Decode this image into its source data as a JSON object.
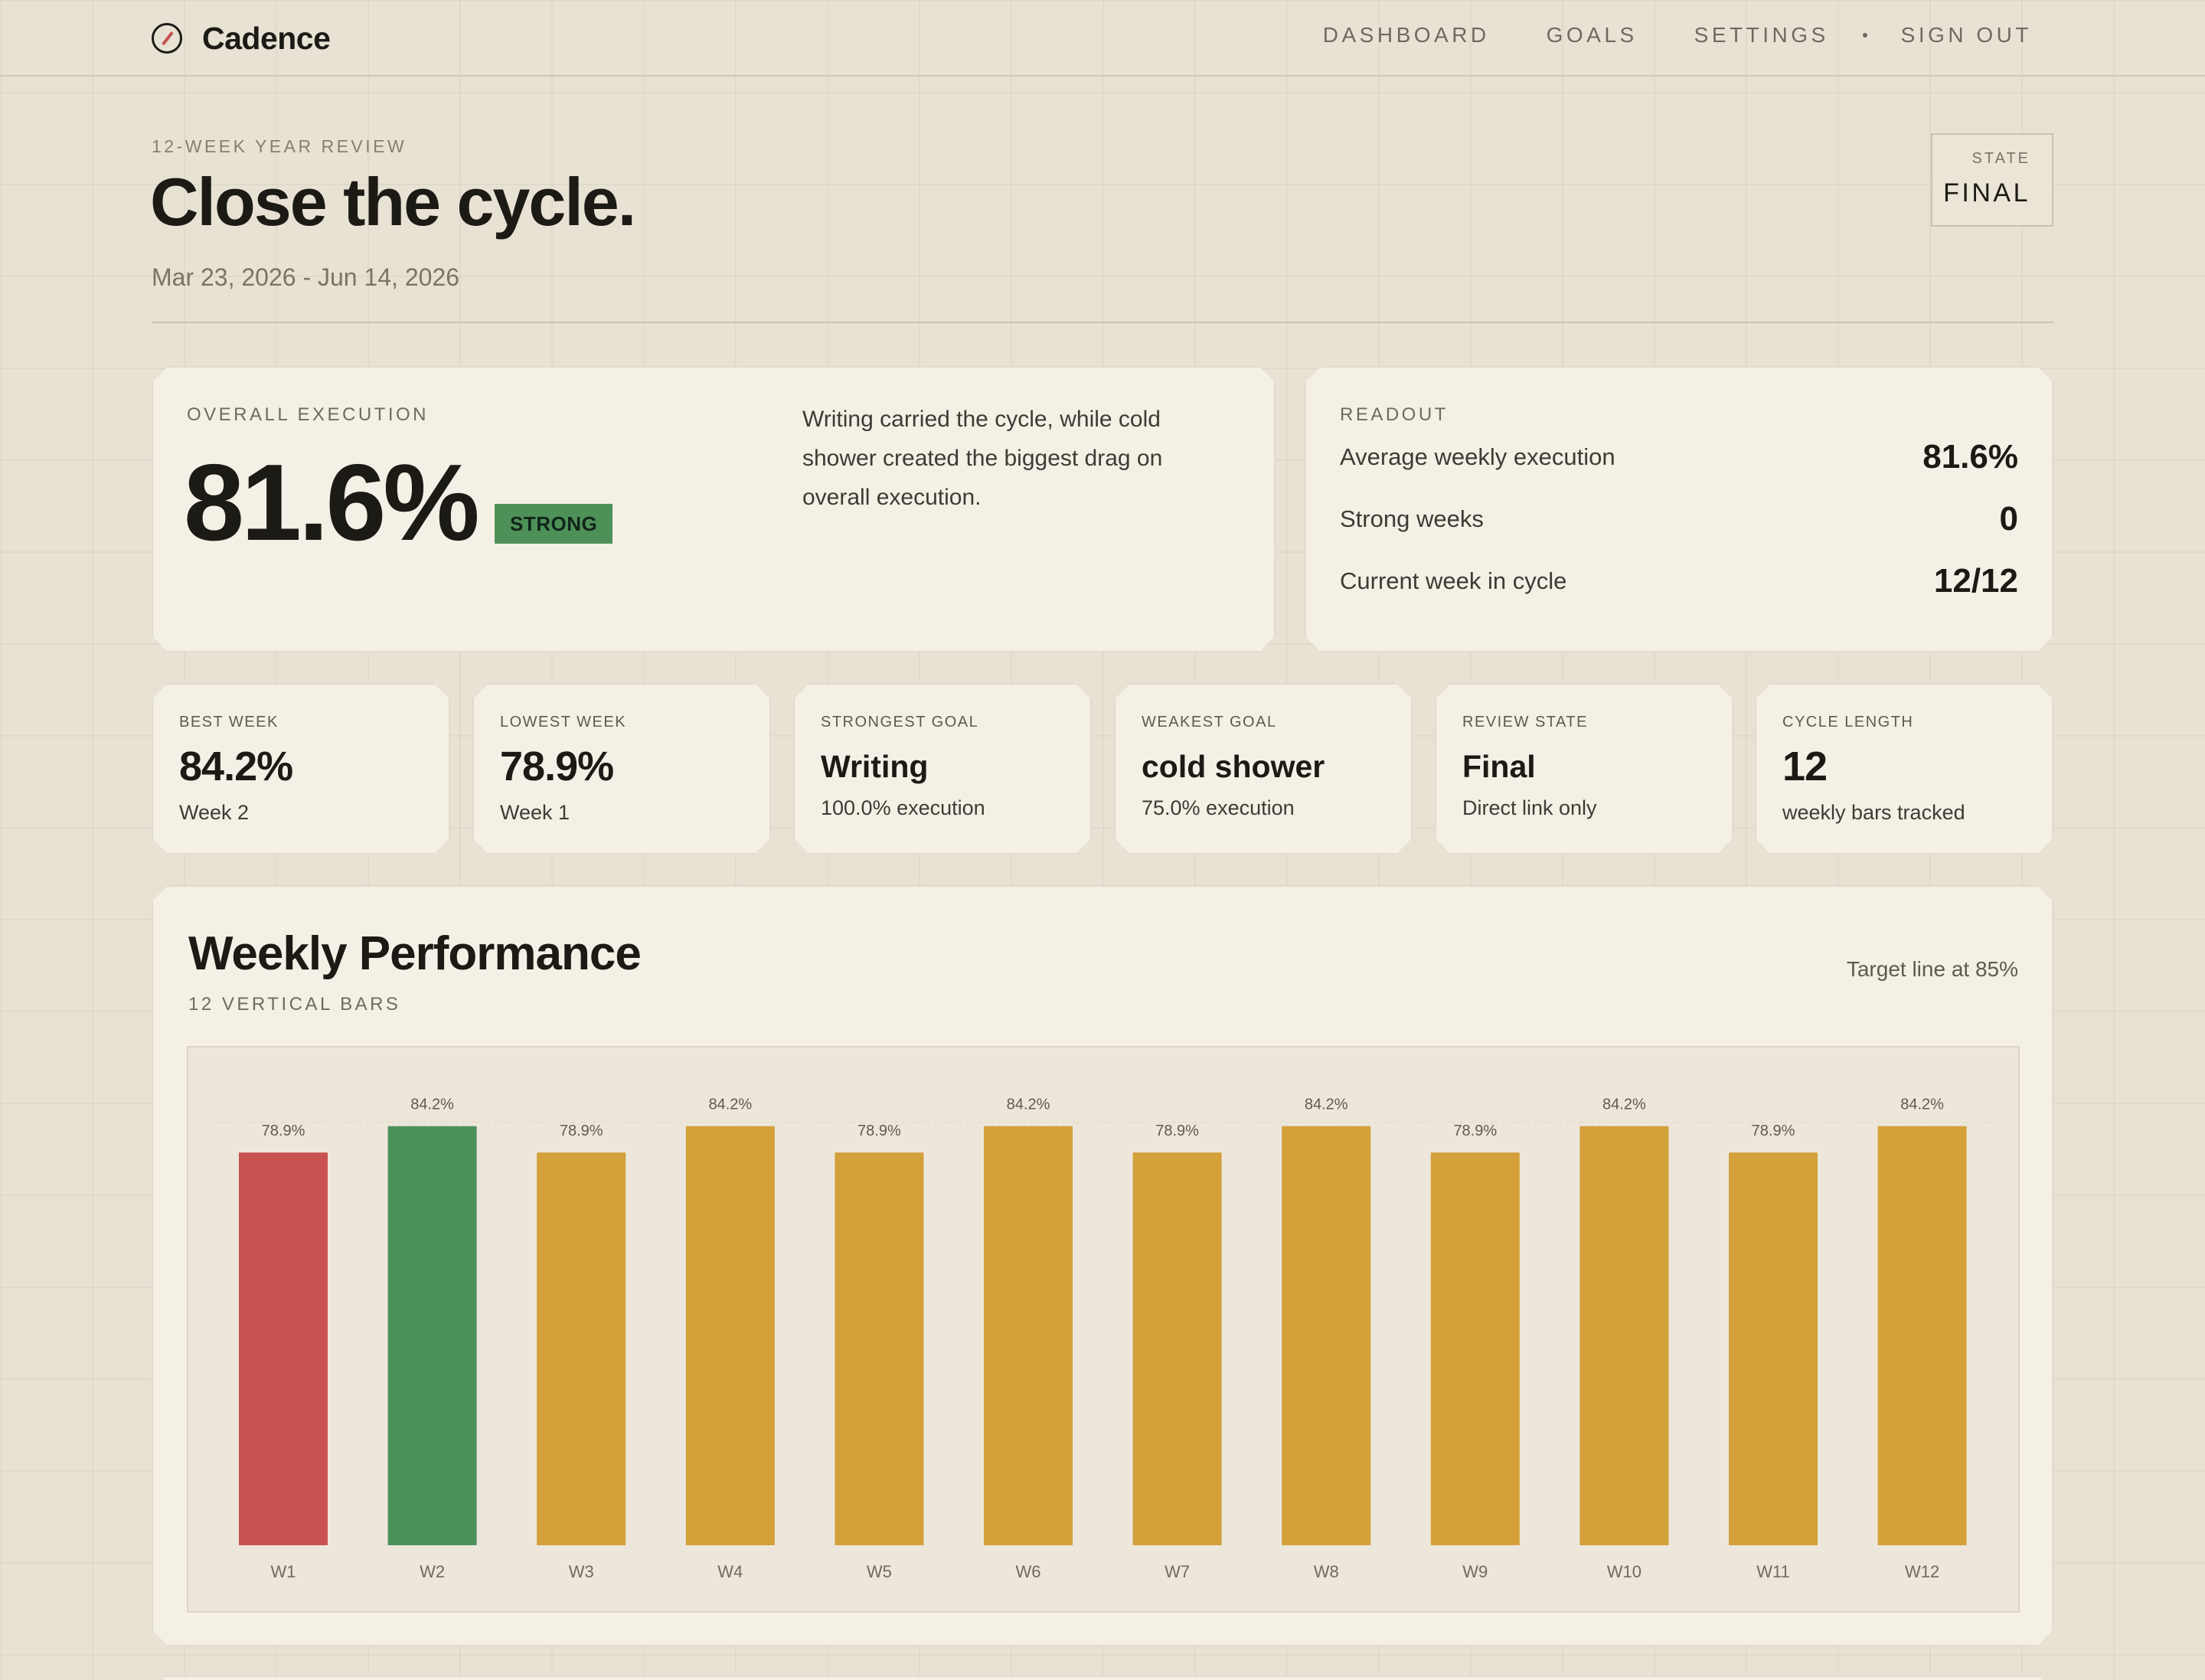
{
  "app": {
    "name": "Cadence",
    "nav": [
      "DASHBOARD",
      "GOALS",
      "SETTINGS"
    ],
    "sign_out": "SIGN OUT"
  },
  "review": {
    "eyebrow": "12-WEEK YEAR REVIEW",
    "title": "Close the cycle.",
    "date_range": "Mar 23, 2026 - Jun 14, 2026",
    "state_label": "STATE",
    "state_value": "FINAL"
  },
  "execution": {
    "label": "OVERALL EXECUTION",
    "value": "81.6%",
    "badge": "STRONG",
    "summary": "Writing carried the cycle, while cold shower created the biggest drag on overall execution."
  },
  "readout": {
    "label": "READOUT",
    "rows": [
      {
        "key": "Average weekly execution",
        "value": "81.6%"
      },
      {
        "key": "Strong weeks",
        "value": "0"
      },
      {
        "key": "Current week in cycle",
        "value": "12/12"
      }
    ]
  },
  "stats": [
    {
      "label": "BEST WEEK",
      "value": "84.2%",
      "sub": "Week 2"
    },
    {
      "label": "LOWEST WEEK",
      "value": "78.9%",
      "sub": "Week 1"
    },
    {
      "label": "STRONGEST GOAL",
      "value": "Writing",
      "sub": "100.0% execution"
    },
    {
      "label": "WEAKEST GOAL",
      "value": "cold shower",
      "sub": "75.0% execution"
    },
    {
      "label": "REVIEW STATE",
      "value": "Final",
      "sub": "Direct link only"
    },
    {
      "label": "CYCLE LENGTH",
      "value": "12",
      "sub": "weekly bars tracked"
    }
  ],
  "colors": {
    "lowest": "#c85250",
    "best": "#4b915a",
    "normal": "#d3a03a",
    "target_line": "#e6ddcc"
  },
  "chart": {
    "title": "Weekly Performance",
    "subtitle": "12 VERTICAL BARS",
    "note": "Target line at 85%"
  },
  "chart_data": {
    "type": "bar",
    "categories": [
      "W1",
      "W2",
      "W3",
      "W4",
      "W5",
      "W6",
      "W7",
      "W8",
      "W9",
      "W10",
      "W11",
      "W12"
    ],
    "values": [
      78.9,
      84.2,
      78.9,
      84.2,
      78.9,
      84.2,
      78.9,
      84.2,
      78.9,
      84.2,
      78.9,
      84.2
    ],
    "value_labels": [
      "78.9%",
      "84.2%",
      "78.9%",
      "84.2%",
      "78.9%",
      "84.2%",
      "78.9%",
      "84.2%",
      "78.9%",
      "84.2%",
      "78.9%",
      "84.2%"
    ],
    "target": 85,
    "highlight": {
      "lowest": "W1",
      "best": "W2"
    },
    "grid": false,
    "legend": "none"
  }
}
